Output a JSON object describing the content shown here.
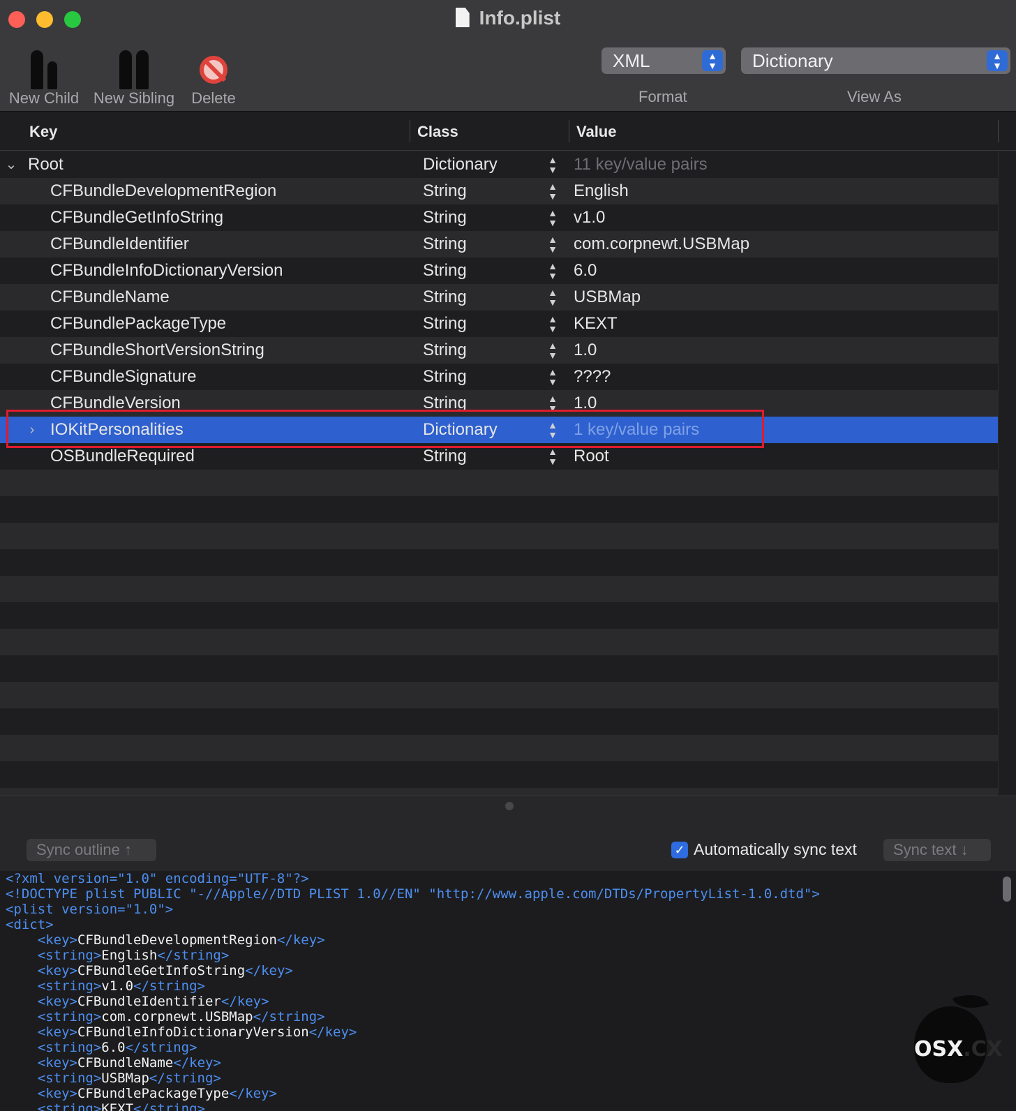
{
  "window": {
    "title": "Info.plist"
  },
  "toolbar": {
    "new_child": "New Child",
    "new_sibling": "New Sibling",
    "delete": "Delete",
    "format": {
      "value": "XML",
      "label": "Format"
    },
    "view_as": {
      "value": "Dictionary",
      "label": "View As"
    }
  },
  "outline": {
    "headers": {
      "key": "Key",
      "class": "Class",
      "value": "Value"
    },
    "rows": [
      {
        "key": "Root",
        "class": "Dictionary",
        "value": "11 key/value pairs"
      },
      {
        "key": "CFBundleDevelopmentRegion",
        "class": "String",
        "value": "English"
      },
      {
        "key": "CFBundleGetInfoString",
        "class": "String",
        "value": "v1.0"
      },
      {
        "key": "CFBundleIdentifier",
        "class": "String",
        "value": "com.corpnewt.USBMap"
      },
      {
        "key": "CFBundleInfoDictionaryVersion",
        "class": "String",
        "value": "6.0"
      },
      {
        "key": "CFBundleName",
        "class": "String",
        "value": "USBMap"
      },
      {
        "key": "CFBundlePackageType",
        "class": "String",
        "value": "KEXT"
      },
      {
        "key": "CFBundleShortVersionString",
        "class": "String",
        "value": "1.0"
      },
      {
        "key": "CFBundleSignature",
        "class": "String",
        "value": "????"
      },
      {
        "key": "CFBundleVersion",
        "class": "String",
        "value": "1.0"
      },
      {
        "key": "IOKitPersonalities",
        "class": "Dictionary",
        "value": "1 key/value pairs"
      },
      {
        "key": "OSBundleRequired",
        "class": "String",
        "value": "Root"
      }
    ]
  },
  "sync": {
    "sync_outline": "Sync outline ↑",
    "auto_sync_label": "Automatically sync text",
    "auto_sync_checked": true,
    "sync_text": "Sync text ↓"
  },
  "xml_lines": [
    "<?xml version=\"1.0\" encoding=\"UTF-8\"?>",
    "<!DOCTYPE plist PUBLIC \"-//Apple//DTD PLIST 1.0//EN\" \"http://www.apple.com/DTDs/PropertyList-1.0.dtd\">",
    "<plist version=\"1.0\">",
    "<dict>",
    "CFBundleDevelopmentRegion",
    "English",
    "CFBundleGetInfoString",
    "v1.0",
    "CFBundleIdentifier",
    "com.corpnewt.USBMap",
    "CFBundleInfoDictionaryVersion",
    "6.0",
    "CFBundleName",
    "USBMap",
    "CFBundlePackageType",
    "KEXT"
  ],
  "watermark": {
    "text1": "OSX",
    "text2": ".CX"
  },
  "colors": {
    "selection": "#2e60cf",
    "highlight_box": "#e01b2e",
    "xml_tag": "#4d8ef0"
  }
}
